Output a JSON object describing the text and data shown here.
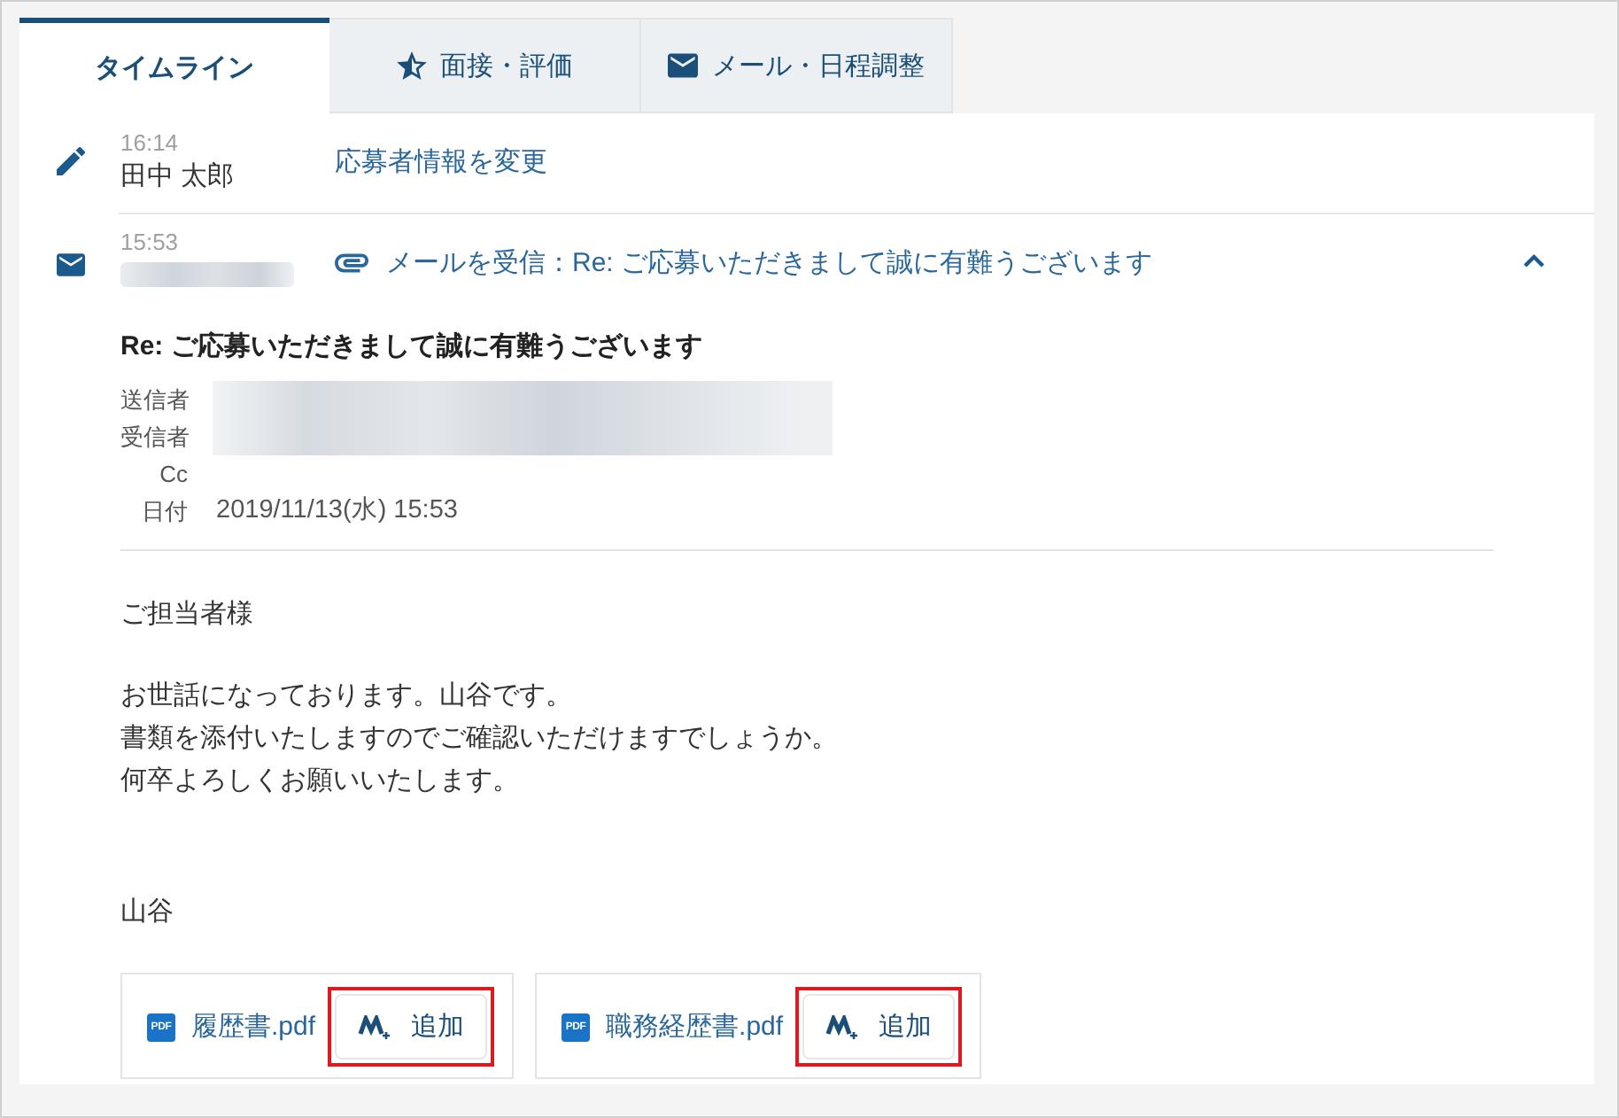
{
  "tabs": [
    {
      "kind": "plain",
      "label": "タイムライン",
      "selected": true
    },
    {
      "kind": "star",
      "label": "面接・評価",
      "selected": false
    },
    {
      "kind": "mail",
      "label": "メール・日程調整",
      "selected": false
    }
  ],
  "timeline": [
    {
      "kind": "edit",
      "time": "16:14",
      "author": "田中 太郎",
      "author_blurred": false,
      "action": "応募者情報を変更",
      "has_attachment": false
    },
    {
      "kind": "mail",
      "time": "15:53",
      "author_blurred": true,
      "action": "メールを受信：Re: ご応募いただきまして誠に有難うございます",
      "has_attachment": true,
      "expanded": true,
      "email": {
        "subject": "Re: ご応募いただきまして誠に有難うございます",
        "fields": [
          {
            "label": "送信者",
            "blurred": true
          },
          {
            "label": "受信者",
            "blurred": true
          },
          {
            "label": "Cc",
            "blurred": false
          },
          {
            "label": "日付",
            "value": "2019/11/13(水) 15:53",
            "blurred": false
          }
        ],
        "greeting": "ご担当者様",
        "body_lines": [
          "お世話になっております。山谷です。",
          "書類を添付いたしますのでご確認いただけますでしょうか。",
          "何卒よろしくお願いいたします。"
        ],
        "signature": "山谷",
        "attachments": [
          {
            "file_type": "PDF",
            "name": "履歴書.pdf",
            "button": "追加",
            "highlighted": true
          },
          {
            "file_type": "PDF",
            "name": "職務経歴書.pdf",
            "button": "追加",
            "highlighted": true
          }
        ]
      }
    }
  ]
}
